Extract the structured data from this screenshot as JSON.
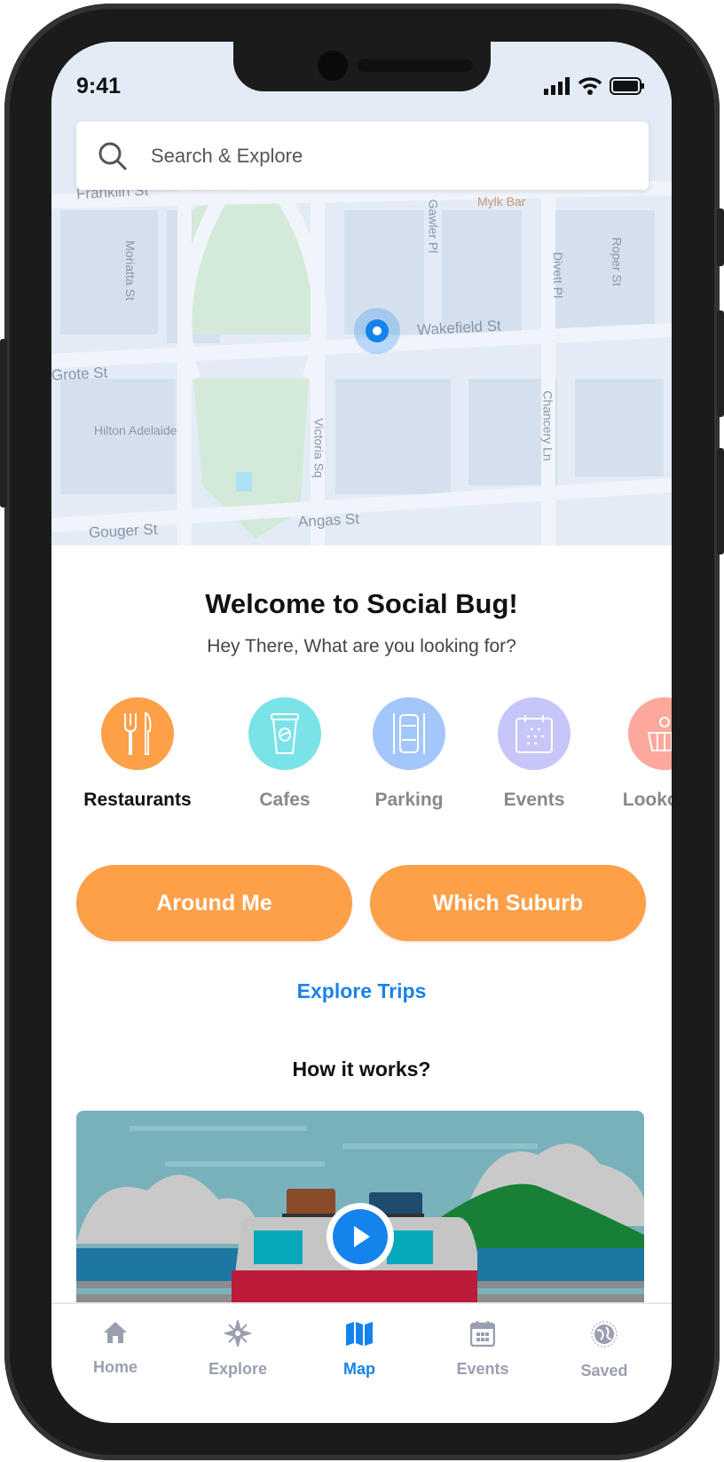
{
  "status_bar": {
    "time": "9:41"
  },
  "search": {
    "placeholder": "Search & Explore",
    "icon": "search-icon"
  },
  "map": {
    "labels": [
      "Franklin St",
      "Mylk Bar",
      "Gawler Pl",
      "Moriatta St",
      "Divett Pl",
      "Roper St",
      "Wakefield St",
      "Grote St",
      "Hilton Adelaide",
      "Victoria Sq",
      "Chancery Ln",
      "Angas St",
      "Gouger St"
    ],
    "pin_color": "#1583ec"
  },
  "welcome": {
    "title": "Welcome to Social Bug!",
    "subtitle": "Hey There, What are you looking for?"
  },
  "categories": [
    {
      "label": "Restaurants",
      "icon": "fork-knife-icon",
      "color": "#fda048",
      "active": true
    },
    {
      "label": "Cafes",
      "icon": "coffee-cup-icon",
      "color": "#7ae3e8"
    },
    {
      "label": "Parking",
      "icon": "car-parking-icon",
      "color": "#a3c6fb"
    },
    {
      "label": "Events",
      "icon": "calendar-icon",
      "color": "#c6c6fb"
    },
    {
      "label": "Lookouts",
      "icon": "basket-icon",
      "color": "#fca89c"
    }
  ],
  "actions": {
    "around_me": "Around Me",
    "which_suburb": "Which Suburb",
    "explore_trips": "Explore Trips"
  },
  "how_it_works": {
    "title": "How it works?"
  },
  "accent": "#fda048",
  "nav": [
    {
      "label": "Home",
      "icon": "home-icon"
    },
    {
      "label": "Explore",
      "icon": "compass-icon"
    },
    {
      "label": "Map",
      "icon": "map-icon",
      "active": true
    },
    {
      "label": "Events",
      "icon": "calendar-icon"
    },
    {
      "label": "Saved",
      "icon": "globe-icon"
    }
  ]
}
